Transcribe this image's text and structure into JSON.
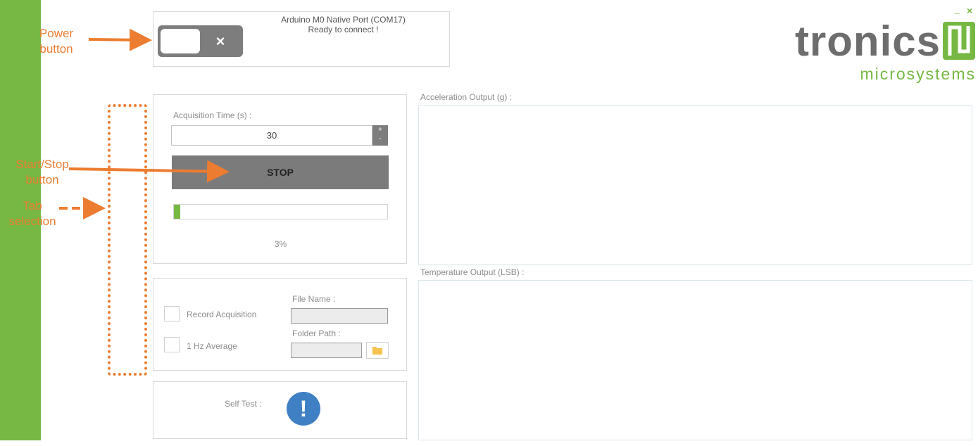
{
  "annotations": {
    "power": [
      "Power",
      "button"
    ],
    "startstop": [
      "Start/Stop",
      "button"
    ],
    "tab": [
      "Tab",
      "selection"
    ]
  },
  "connection": {
    "port": "Arduino M0 Native Port (COM17)",
    "status": "Ready to connect !",
    "toggle_icon": "close-icon"
  },
  "logo": {
    "name": "tronics",
    "tagline": "microsystems",
    "mark": "tronics-logo-icon"
  },
  "window_controls": {
    "minimize": "_",
    "close": "×"
  },
  "sidebar": {
    "items": [
      "home-icon",
      "tools-icon",
      "lightning-icon",
      "search-chip-icon",
      "device-icon",
      "gear-icon",
      "help-icon"
    ]
  },
  "acquisition": {
    "time_label": "Acquisition Time (s) :",
    "time_value": "30",
    "plus": "+",
    "minus": "-",
    "button_label": "STOP",
    "progress_text": "3%",
    "progress_value": 0.03
  },
  "record": {
    "record_label": "Record Acquisition",
    "average_label": "1 Hz Average",
    "file_name_label": "File Name :",
    "folder_path_label": "Folder Path :",
    "file_name_value": "",
    "folder_path_value": ""
  },
  "self_test": {
    "label": "Self Test :",
    "icon": "exclamation-icon"
  },
  "charts": {
    "acceleration_label": "Acceleration Output (g) :",
    "temperature_label": "Temperature Output (LSB) :"
  },
  "colors": {
    "sidebar": "#76b843",
    "accent_orange": "#ec7c30",
    "logo_gray": "#6d6d6d",
    "logo_green": "#76b843",
    "self_test_blue": "#3f7fc4",
    "button_gray": "#7b7b7b"
  }
}
